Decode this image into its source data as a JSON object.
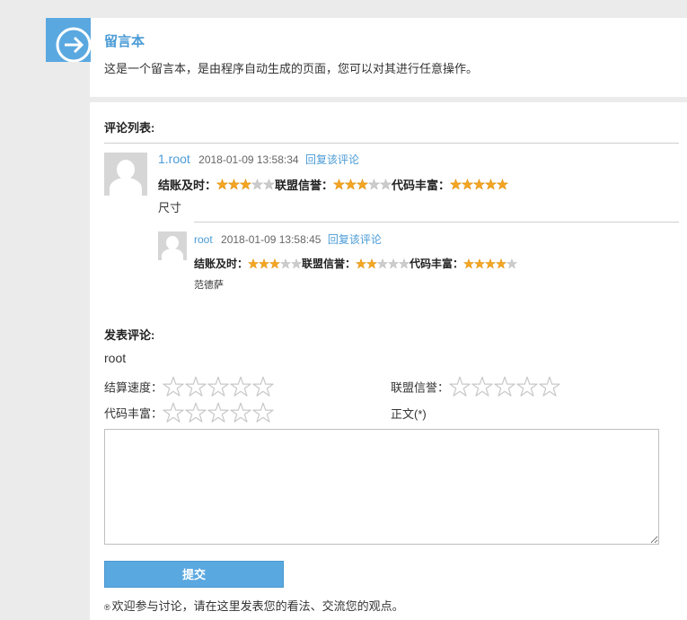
{
  "header": {
    "title": "留言本",
    "description": "这是一个留言本，是由程序自动生成的页面，您可以对其进行任意操作。"
  },
  "comments_section": {
    "title": "评论列表:"
  },
  "comments": [
    {
      "user": "1.root",
      "time": "2018-01-09 13:58:34",
      "reply_label": "回复该评论",
      "text": "尺寸",
      "ratings": [
        {
          "label": "结账及时：",
          "score": 3,
          "max": 5
        },
        {
          "label": "联盟信誉：",
          "score": 3,
          "max": 5
        },
        {
          "label": "代码丰富：",
          "score": 5,
          "max": 5
        }
      ],
      "replies": [
        {
          "user": "root",
          "time": "2018-01-09 13:58:45",
          "reply_label": "回复该评论",
          "text": "范德萨",
          "ratings": [
            {
              "label": "结账及时：",
              "score": 3,
              "max": 5
            },
            {
              "label": "联盟信誉：",
              "score": 2,
              "max": 5
            },
            {
              "label": "代码丰富：",
              "score": 4,
              "max": 5
            }
          ]
        }
      ]
    }
  ],
  "form": {
    "title": "发表评论:",
    "username": "root",
    "rating_fields": [
      {
        "label": "结算速度：",
        "value": 0,
        "max": 5
      },
      {
        "label": "联盟信誉：",
        "value": 0,
        "max": 5
      },
      {
        "label": "代码丰富：",
        "value": 0,
        "max": 5
      }
    ],
    "body_label": "正文(*)",
    "body_value": "",
    "submit_label": "提交",
    "footer_note": "欢迎参与讨论，请在这里发表您的看法、交流您的观点。"
  },
  "colors": {
    "accent": "#5aa8e0",
    "link": "#4a9bd6",
    "star_filled": "#f5a623",
    "star_empty": "#cccccc"
  }
}
